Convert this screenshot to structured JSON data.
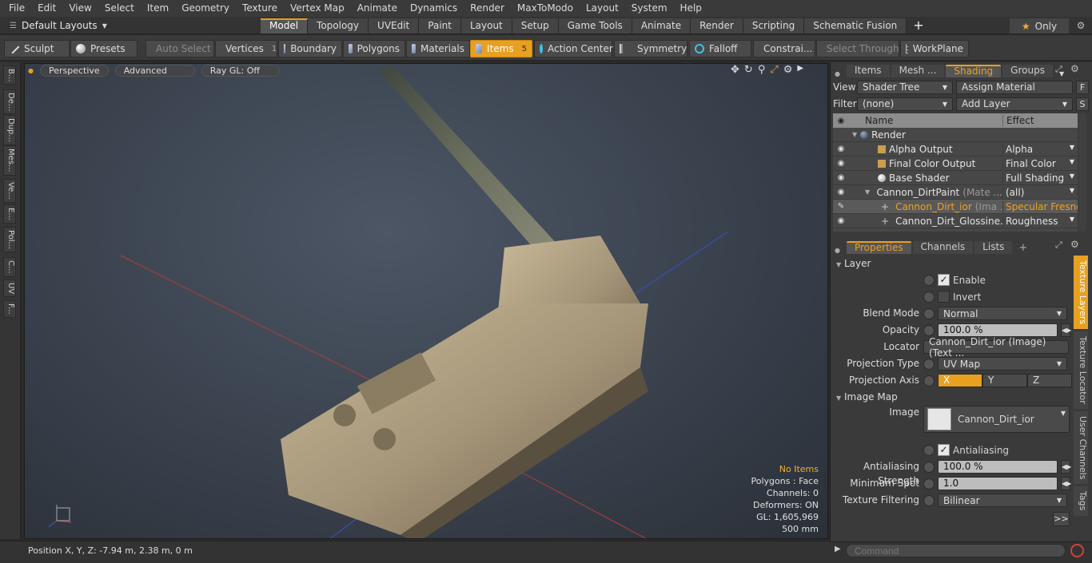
{
  "menu": [
    "File",
    "Edit",
    "View",
    "Select",
    "Item",
    "Geometry",
    "Texture",
    "Vertex Map",
    "Animate",
    "Dynamics",
    "Render",
    "MaxToModo",
    "Layout",
    "System",
    "Help"
  ],
  "layouts": {
    "label": "Default Layouts"
  },
  "tabs": [
    "Model",
    "Topology",
    "UVEdit",
    "Paint",
    "Layout",
    "Setup",
    "Game Tools",
    "Animate",
    "Render",
    "Scripting",
    "Schematic Fusion"
  ],
  "only_label": "Only",
  "toolbar": {
    "sculpt": "Sculpt",
    "presets": "Presets",
    "auto_select": "Auto Select",
    "vertices": "Vertices",
    "vertices_count": "1",
    "boundary": "Boundary",
    "polygons": "Polygons",
    "materials": "Materials",
    "items": "Items",
    "items_count": "5",
    "action_center": "Action Center",
    "symmetry": "Symmetry",
    "falloff": "Falloff",
    "constraints": "Constrai...",
    "select_through": "Select Through",
    "workplane": "WorkPlane"
  },
  "left_tabs": [
    "B...",
    "De...",
    "Dup...",
    "Mes...",
    "Ve...",
    "E...",
    "Pol...",
    "C...",
    "UV",
    "F..."
  ],
  "viewport": {
    "perspective": "Perspective",
    "advanced": "Advanced",
    "raygl": "Ray GL: Off",
    "hud": {
      "no_items": "No Items",
      "polygons": "Polygons : Face",
      "channels": "Channels: 0",
      "deformers": "Deformers: ON",
      "gl": "GL: 1,605,969",
      "scale": "500 mm"
    }
  },
  "status": {
    "position": "Position X, Y, Z:   -7.94 m, 2.38 m, 0 m"
  },
  "top_panel": {
    "tabs": [
      "Items",
      "Mesh ...",
      "Shading",
      "Groups"
    ],
    "view_label": "View",
    "view_value": "Shader Tree",
    "assign_material": "Assign Material",
    "filter_label": "Filter",
    "filter_value": "(none)",
    "add_layer": "Add Layer",
    "col_name": "Name",
    "col_effect": "Effect",
    "rows": [
      {
        "name": "Render",
        "sub": "",
        "effect": ""
      },
      {
        "name": "Alpha Output",
        "sub": "",
        "effect": "Alpha"
      },
      {
        "name": "Final Color Output",
        "sub": "",
        "effect": "Final Color"
      },
      {
        "name": "Base Shader",
        "sub": "",
        "effect": "Full Shading"
      },
      {
        "name": "Cannon_DirtPaint",
        "sub": "(Mate ...",
        "effect": "(all)"
      },
      {
        "name": "Cannon_Dirt_ior",
        "sub": "(Ima ...",
        "effect": "Specular Fresnel"
      },
      {
        "name": "Cannon_Dirt_Glossine...",
        "sub": "",
        "effect": "Roughness"
      }
    ]
  },
  "properties": {
    "tabs": [
      "Properties",
      "Channels",
      "Lists"
    ],
    "layer_section": "Layer",
    "enable": "Enable",
    "invert": "Invert",
    "blend_mode_label": "Blend Mode",
    "blend_mode": "Normal",
    "opacity_label": "Opacity",
    "opacity": "100.0 %",
    "locator_label": "Locator",
    "locator": "Cannon_Dirt_ior (Image) (Text ...",
    "proj_type_label": "Projection Type",
    "proj_type": "UV Map",
    "proj_axis_label": "Projection Axis",
    "axis": [
      "X",
      "Y",
      "Z"
    ],
    "image_map_section": "Image Map",
    "image_label": "Image",
    "image": "Cannon_Dirt_ior",
    "antialiasing": "Antialiasing",
    "aa_strength_label": "Antialiasing Strength",
    "aa_strength": "100.0 %",
    "min_spot_label": "Minimum Spot",
    "min_spot": "1.0",
    "tex_filter_label": "Texture Filtering",
    "tex_filter": "Bilinear",
    "more": ">>"
  },
  "side_tabs": [
    "Texture Layers",
    "Texture Locator",
    "User Channels",
    "Tags"
  ],
  "command_placeholder": "Command"
}
